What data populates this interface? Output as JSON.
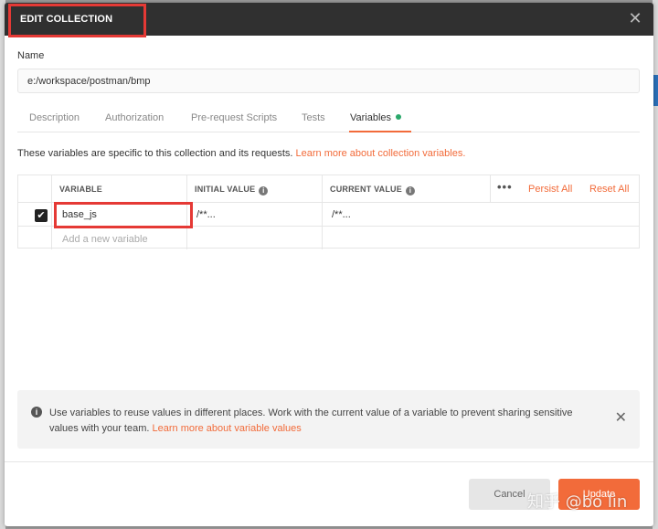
{
  "modal": {
    "title": "EDIT COLLECTION",
    "close_glyph": "✕"
  },
  "name": {
    "label": "Name",
    "value": "e:/workspace/postman/bmp"
  },
  "tabs": [
    {
      "label": "Description",
      "active": false
    },
    {
      "label": "Authorization",
      "active": false
    },
    {
      "label": "Pre-request Scripts",
      "active": false
    },
    {
      "label": "Tests",
      "active": false
    },
    {
      "label": "Variables",
      "active": true
    }
  ],
  "variables_tab": {
    "description": "These variables are specific to this collection and its requests.",
    "learn_more": "Learn more about collection variables."
  },
  "table": {
    "headers": {
      "variable": "VARIABLE",
      "initial_value": "INITIAL VALUE",
      "current_value": "CURRENT VALUE"
    },
    "more_glyph": "•••",
    "persist_all": "Persist All",
    "reset_all": "Reset All",
    "rows": [
      {
        "checked": true,
        "variable": "base_js",
        "initial_value": "/**...",
        "current_value": "/**..."
      }
    ],
    "add_placeholder": "Add a new variable"
  },
  "infobox": {
    "text": "Use variables to reuse values in different places. Work with the current value of a variable to prevent sharing sensitive values with your team.",
    "link": "Learn more about variable values"
  },
  "footer": {
    "cancel_label": "Cancel",
    "update_label": "Update"
  },
  "watermark": "知乎 @bo lin",
  "colors": {
    "accent": "#f26b3a",
    "header": "#303030",
    "highlight": "#e53935",
    "status_dot": "#2aa86b"
  }
}
